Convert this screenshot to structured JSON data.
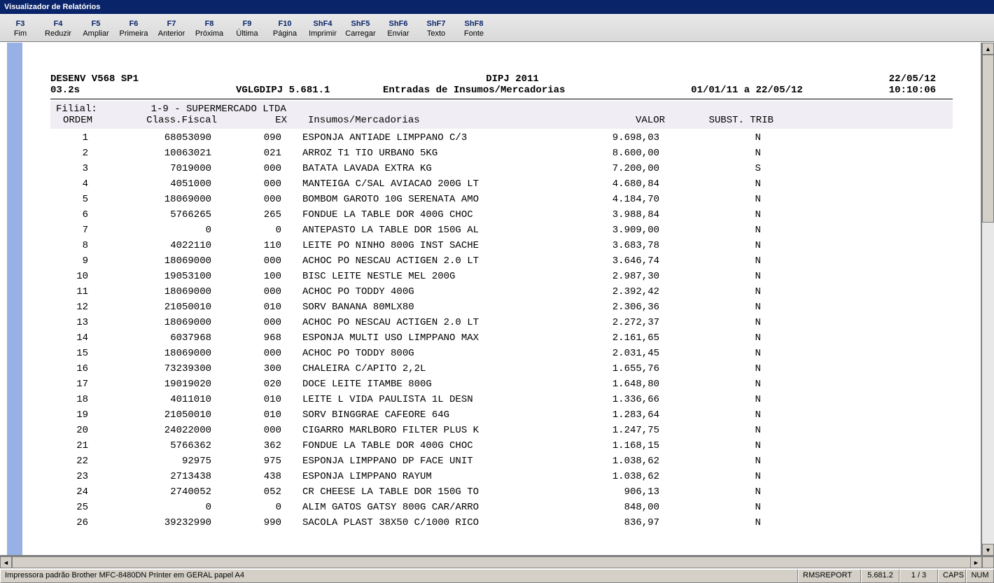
{
  "window": {
    "title": "Visualizador de Relatórios"
  },
  "toolbar": [
    {
      "key": "F3",
      "label": "Fim"
    },
    {
      "key": "F4",
      "label": "Reduzir"
    },
    {
      "key": "F5",
      "label": "Ampliar"
    },
    {
      "key": "F6",
      "label": "Primeira"
    },
    {
      "key": "F7",
      "label": "Anterior"
    },
    {
      "key": "F8",
      "label": "Próxima"
    },
    {
      "key": "F9",
      "label": "Última"
    },
    {
      "key": "F10",
      "label": "Página"
    },
    {
      "key": "ShF4",
      "label": "Imprimir"
    },
    {
      "key": "ShF5",
      "label": "Carregar"
    },
    {
      "key": "ShF6",
      "label": "Enviar"
    },
    {
      "key": "ShF7",
      "label": "Texto"
    },
    {
      "key": "ShF8",
      "label": "Fonte"
    }
  ],
  "report": {
    "header": {
      "env": "DESENV V568 SP1",
      "title_right": "DIPJ 2011",
      "date": "22/05/12",
      "time_stat": "03.2s",
      "program": "VGLGDIPJ 5.681.1",
      "report_title": "Entradas de Insumos/Mercadorias",
      "period": "01/01/11 a 22/05/12",
      "time": "10:10:06"
    },
    "subheader": {
      "filial_label": "Filial:",
      "filial_value": "1-9 - SUPERMERCADO LTDA"
    },
    "columns": {
      "ordem": "ORDEM",
      "class_fiscal": "Class.Fiscal",
      "ex": "EX",
      "insumos": "Insumos/Mercadorias",
      "valor": "VALOR",
      "subst_trib": "SUBST. TRIB"
    },
    "rows": [
      {
        "ordem": "1",
        "class_fiscal": "68053090",
        "ex": "090",
        "desc": "ESPONJA ANTIADE LIMPPANO C/3",
        "valor": "9.698,03",
        "st": "N"
      },
      {
        "ordem": "2",
        "class_fiscal": "10063021",
        "ex": "021",
        "desc": "ARROZ T1 TIO URBANO 5KG",
        "valor": "8.600,00",
        "st": "N"
      },
      {
        "ordem": "3",
        "class_fiscal": "7019000",
        "ex": "000",
        "desc": "BATATA LAVADA EXTRA KG",
        "valor": "7.200,00",
        "st": "S"
      },
      {
        "ordem": "4",
        "class_fiscal": "4051000",
        "ex": "000",
        "desc": "MANTEIGA C/SAL AVIACAO 200G LT",
        "valor": "4.680,84",
        "st": "N"
      },
      {
        "ordem": "5",
        "class_fiscal": "18069000",
        "ex": "000",
        "desc": "BOMBOM GAROTO 10G SERENATA AMO",
        "valor": "4.184,70",
        "st": "N"
      },
      {
        "ordem": "6",
        "class_fiscal": "5766265",
        "ex": "265",
        "desc": "FONDUE LA TABLE DOR 400G CHOC",
        "valor": "3.988,84",
        "st": "N"
      },
      {
        "ordem": "7",
        "class_fiscal": "0",
        "ex": "0",
        "desc": "ANTEPASTO LA TABLE DOR 150G AL",
        "valor": "3.909,00",
        "st": "N"
      },
      {
        "ordem": "8",
        "class_fiscal": "4022110",
        "ex": "110",
        "desc": "LEITE PO NINHO 800G INST SACHE",
        "valor": "3.683,78",
        "st": "N"
      },
      {
        "ordem": "9",
        "class_fiscal": "18069000",
        "ex": "000",
        "desc": "ACHOC PO NESCAU ACTIGEN 2.0 LT",
        "valor": "3.646,74",
        "st": "N"
      },
      {
        "ordem": "10",
        "class_fiscal": "19053100",
        "ex": "100",
        "desc": "BISC LEITE NESTLE MEL 200G",
        "valor": "2.987,30",
        "st": "N"
      },
      {
        "ordem": "11",
        "class_fiscal": "18069000",
        "ex": "000",
        "desc": "ACHOC PO TODDY 400G",
        "valor": "2.392,42",
        "st": "N"
      },
      {
        "ordem": "12",
        "class_fiscal": "21050010",
        "ex": "010",
        "desc": "SORV BANANA 80MLX80",
        "valor": "2.306,36",
        "st": "N"
      },
      {
        "ordem": "13",
        "class_fiscal": "18069000",
        "ex": "000",
        "desc": "ACHOC PO NESCAU ACTIGEN 2.0 LT",
        "valor": "2.272,37",
        "st": "N"
      },
      {
        "ordem": "14",
        "class_fiscal": "6037968",
        "ex": "968",
        "desc": "ESPONJA MULTI USO LIMPPANO MAX",
        "valor": "2.161,65",
        "st": "N"
      },
      {
        "ordem": "15",
        "class_fiscal": "18069000",
        "ex": "000",
        "desc": "ACHOC PO TODDY 800G",
        "valor": "2.031,45",
        "st": "N"
      },
      {
        "ordem": "16",
        "class_fiscal": "73239300",
        "ex": "300",
        "desc": "CHALEIRA C/APITO 2,2L",
        "valor": "1.655,76",
        "st": "N"
      },
      {
        "ordem": "17",
        "class_fiscal": "19019020",
        "ex": "020",
        "desc": "DOCE LEITE ITAMBE 800G",
        "valor": "1.648,80",
        "st": "N"
      },
      {
        "ordem": "18",
        "class_fiscal": "4011010",
        "ex": "010",
        "desc": "LEITE L VIDA PAULISTA 1L DESN",
        "valor": "1.336,66",
        "st": "N"
      },
      {
        "ordem": "19",
        "class_fiscal": "21050010",
        "ex": "010",
        "desc": "SORV BINGGRAE CAFEORE 64G",
        "valor": "1.283,64",
        "st": "N"
      },
      {
        "ordem": "20",
        "class_fiscal": "24022000",
        "ex": "000",
        "desc": "CIGARRO MARLBORO FILTER PLUS K",
        "valor": "1.247,75",
        "st": "N"
      },
      {
        "ordem": "21",
        "class_fiscal": "5766362",
        "ex": "362",
        "desc": "FONDUE LA TABLE DOR 400G CHOC",
        "valor": "1.168,15",
        "st": "N"
      },
      {
        "ordem": "22",
        "class_fiscal": "92975",
        "ex": "975",
        "desc": "ESPONJA LIMPPANO DP FACE UNIT",
        "valor": "1.038,62",
        "st": "N"
      },
      {
        "ordem": "23",
        "class_fiscal": "2713438",
        "ex": "438",
        "desc": "ESPONJA LIMPPANO RAYUM",
        "valor": "1.038,62",
        "st": "N"
      },
      {
        "ordem": "24",
        "class_fiscal": "2740052",
        "ex": "052",
        "desc": "CR CHEESE LA TABLE DOR 150G TO",
        "valor": "906,13",
        "st": "N"
      },
      {
        "ordem": "25",
        "class_fiscal": "0",
        "ex": "0",
        "desc": "ALIM GATOS GATSY 800G CAR/ARRO",
        "valor": "848,00",
        "st": "N"
      },
      {
        "ordem": "26",
        "class_fiscal": "39232990",
        "ex": "990",
        "desc": "SACOLA PLAST 38X50 C/1000 RICO",
        "valor": "836,97",
        "st": "N"
      }
    ]
  },
  "status": {
    "printer": "Impressora padrão Brother MFC-8480DN Printer em GERAL  papel A4",
    "app": "RMSREPORT",
    "version": "5.681.2",
    "page": "1 / 3",
    "caps": "CAPS",
    "num": "NUM"
  }
}
